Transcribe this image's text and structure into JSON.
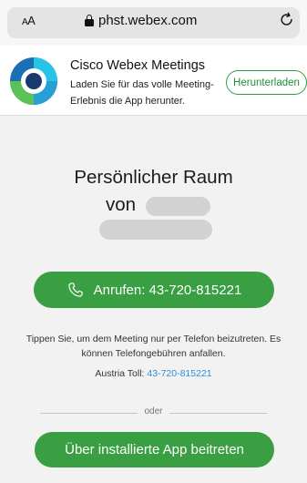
{
  "browser": {
    "text_size_button": "AA",
    "url": "phst.webex.com"
  },
  "banner": {
    "app_name": "Cisco Webex Meetings",
    "description": "Laden Sie für das volle Meeting-Erlebnis die App herunter.",
    "download_label": "Herunterladen"
  },
  "main": {
    "title": "Persönlicher Raum",
    "von_label": "von",
    "call_button": "Anrufen: 43-720-815221",
    "call_info": "Tippen Sie, um dem Meeting nur per Telefon beizutreten. Es können Telefongebühren anfallen.",
    "toll_label": "Austria Toll:",
    "toll_number": "43-720-815221",
    "divider_label": "oder",
    "app_button": "Über installierte App beitreten"
  },
  "colors": {
    "accent_green": "#3a9f43",
    "link_blue": "#2f8fd6"
  },
  "icons": [
    "lock-icon",
    "reload-icon",
    "webex-logo",
    "phone-icon"
  ]
}
